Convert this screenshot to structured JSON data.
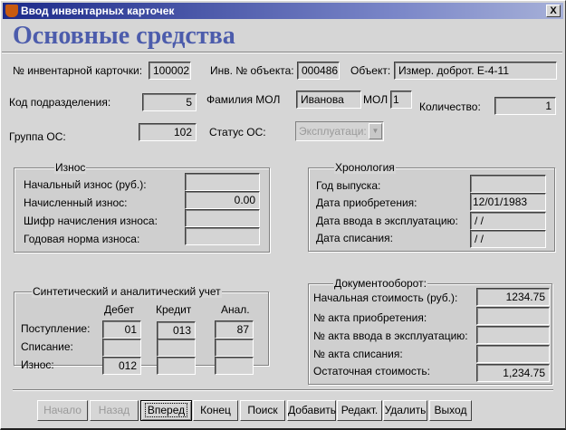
{
  "window": {
    "title": "Ввод инвентарных карточек",
    "close": "X"
  },
  "heading": "Основные средства",
  "top": {
    "card_no_label": "№ инвентарной карточки:",
    "card_no": "100002",
    "obj_no_label": "Инв. № объекта:",
    "obj_no": "000486",
    "object_label": "Объект:",
    "object": "Измер. доброт. Е-4-11",
    "dept_label": "Код подразделения:",
    "dept": "5",
    "mol_name_label": "Фамилия МОЛ",
    "mol_name": "Иванова",
    "mol_label": "МОЛ",
    "mol": "1",
    "qty_label": "Количество:",
    "qty": "1",
    "group_label": "Группа ОС:",
    "group": "102",
    "status_label": "Статус ОС:",
    "status": "Эксплуатаци:"
  },
  "iznos": {
    "title": "Износ",
    "rows": [
      {
        "label": "Начальный износ (руб.):",
        "value": ""
      },
      {
        "label": "Начисленный износ:",
        "value": "0.00"
      },
      {
        "label": "Шифр начисления износа:",
        "value": ""
      },
      {
        "label": "Годовая норма износа:",
        "value": ""
      }
    ]
  },
  "chron": {
    "title": "Хронология",
    "rows": [
      {
        "label": "Год выпуска:",
        "value": ""
      },
      {
        "label": "Дата приобретения:",
        "value": "12/01/1983"
      },
      {
        "label": "Дата ввода в эксплуатацию:",
        "value": " / /"
      },
      {
        "label": "Дата списания:",
        "value": " / /"
      }
    ]
  },
  "synth": {
    "title": "Синтетический и аналитический учет",
    "cols": [
      "Дебет",
      "Кредит",
      "Анал."
    ],
    "rows": [
      {
        "label": "Поступление:",
        "values": [
          "01",
          "013",
          "87"
        ]
      },
      {
        "label": "Списание:",
        "values": [
          "",
          "",
          ""
        ]
      },
      {
        "label": "Износ:",
        "values": [
          "012",
          "",
          ""
        ]
      }
    ]
  },
  "docs": {
    "title": "Документооборот:",
    "rows": [
      {
        "label": "Начальная стоимость (руб.):",
        "value": "1234.75"
      },
      {
        "label": "№ акта приобретения:",
        "value": ""
      },
      {
        "label": "№ акта ввода в эксплуатацию:",
        "value": ""
      },
      {
        "label": "№ акта списания:",
        "value": ""
      },
      {
        "label": "Остаточная стоимость:",
        "value": "1,234.75"
      }
    ]
  },
  "buttons": [
    "Начало",
    "Назад",
    "Вперед",
    "Конец",
    "Поиск",
    "Добавить",
    "Редакт.",
    "Удалить",
    "Выход"
  ]
}
